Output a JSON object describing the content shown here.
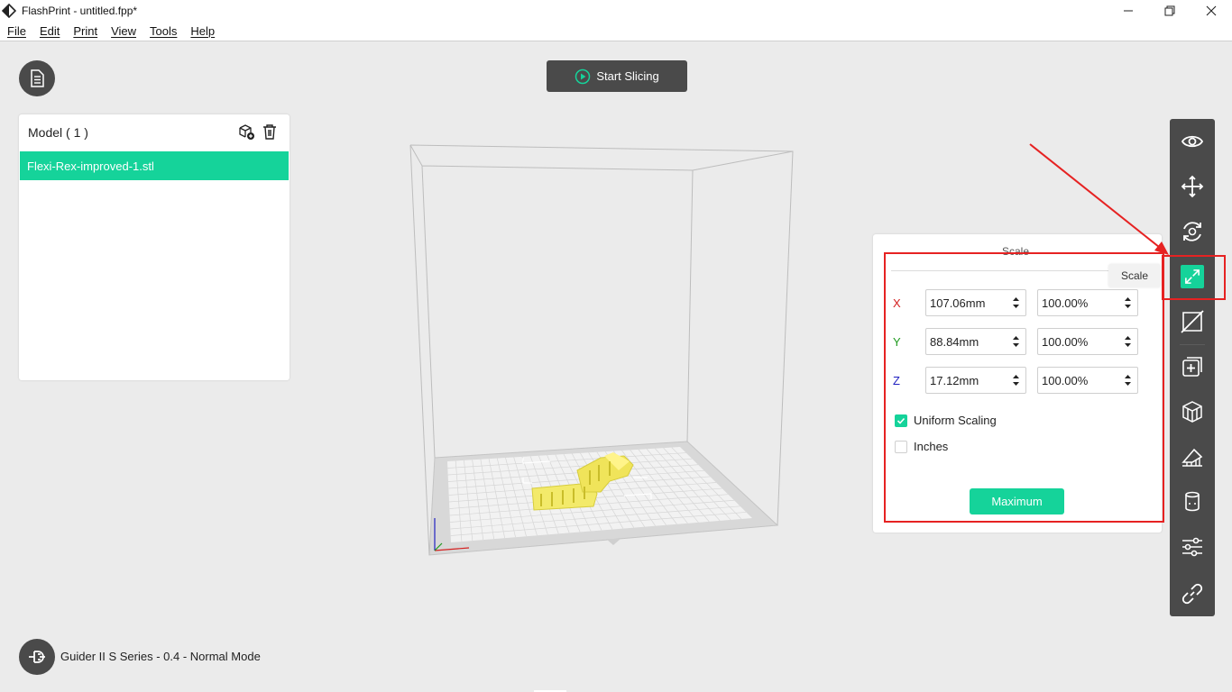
{
  "window": {
    "title": "FlashPrint - untitled.fpp*",
    "controls": [
      "minimize-icon",
      "restore-icon",
      "close-icon"
    ]
  },
  "menu": [
    "File",
    "Edit",
    "Print",
    "View",
    "Tools",
    "Help"
  ],
  "slice_button": {
    "label": "Start Slicing",
    "icon": "play-icon"
  },
  "model_panel": {
    "header": "Model ( 1 )",
    "items": [
      "Flexi-Rex-improved-1.stl"
    ]
  },
  "scale_panel": {
    "title": "Scale",
    "rows": [
      {
        "axis": "X",
        "size": "107.06mm",
        "percent": "100.00%",
        "color": "#d42020"
      },
      {
        "axis": "Y",
        "size": "88.84mm",
        "percent": "100.00%",
        "color": "#1f9a1f"
      },
      {
        "axis": "Z",
        "size": "17.12mm",
        "percent": "100.00%",
        "color": "#2020c0"
      }
    ],
    "uniform_scaling": {
      "label": "Uniform Scaling",
      "checked": true
    },
    "inches": {
      "label": "Inches",
      "checked": false
    },
    "maximum_label": "Maximum"
  },
  "tooltip": "Scale",
  "toolbar": [
    "eye-icon",
    "move-icon",
    "rotate-icon",
    "scale-icon",
    "cut-icon",
    "add-icon",
    "split-icon",
    "support-icon",
    "extruder-icon",
    "settings-icon",
    "link-icon"
  ],
  "status": {
    "printer": "Guider II S Series - 0.4 - Normal Mode"
  },
  "colors": {
    "accent": "#15d39a",
    "dark": "#4a4a4a",
    "annotation": "#e62222",
    "model": "#f3ea6a"
  }
}
